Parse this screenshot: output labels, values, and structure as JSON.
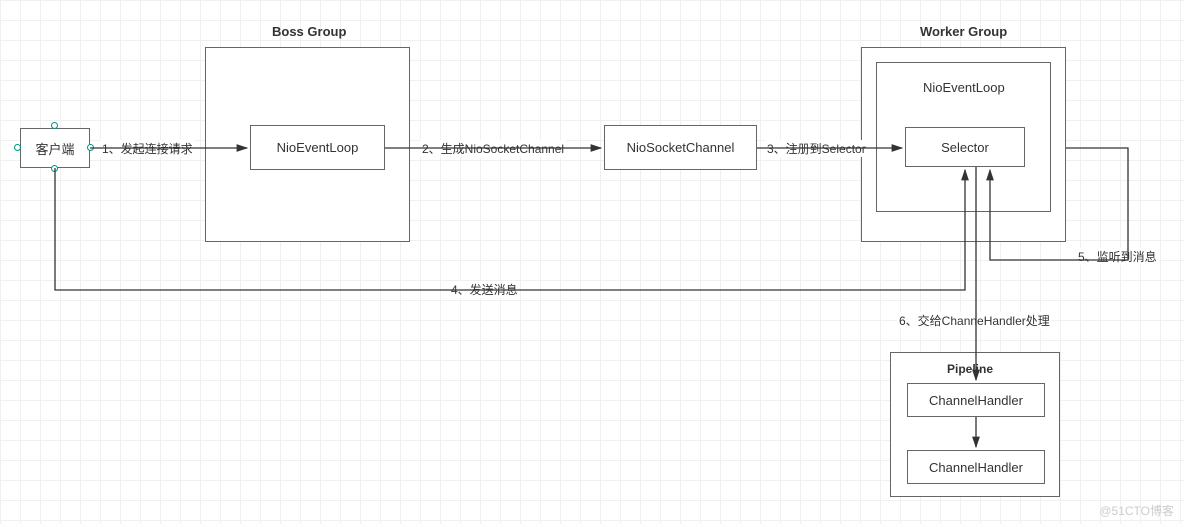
{
  "boxes": {
    "client": "客户端",
    "bossGroup": "Boss Group",
    "bossNioEventLoop": "NioEventLoop",
    "nioSocketChannel": "NioSocketChannel",
    "workerGroup": "Worker Group",
    "workerNioEventLoop": "NioEventLoop",
    "selector": "Selector",
    "pipeline": "Pipeline",
    "channelHandler1": "ChannelHandler",
    "channelHandler2": "ChannelHandler"
  },
  "edges": {
    "e1": "1、发起连接请求",
    "e2": "2、生成NioSocketChannel",
    "e3": "3、注册到Selector",
    "e4": "4、发送消息",
    "e5": "5、监听到消息",
    "e6": "6、交给ChanneHandler处理"
  },
  "watermark": "@51CTO博客"
}
